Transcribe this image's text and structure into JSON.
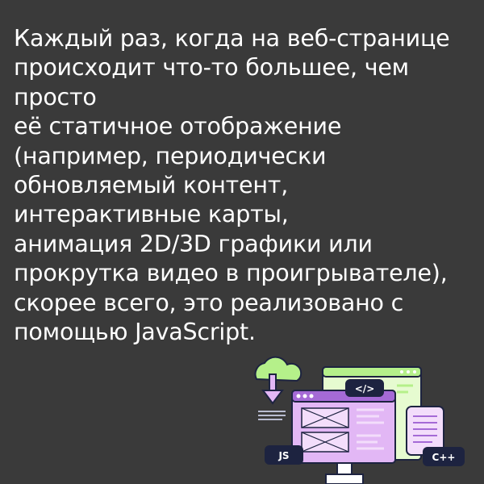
{
  "paragraph": {
    "lines": [
      "Каждый раз, когда на веб-странице",
      "происходит что-то большее, чем",
      "просто",
      "её статичное отображение",
      "(например, периодически",
      "обновляемый контент,",
      "интерактивные карты,",
      "анимация 2D/3D графики или",
      "прокрутка видео в проигрывателе),",
      "скорее всего, это реализовано с",
      "помощью JavaScript."
    ]
  },
  "illustration": {
    "code_tag": "</>",
    "js_badge": "JS",
    "cpp_badge": "C++",
    "icons": [
      "cloud-download-icon",
      "browser-window",
      "code-window",
      "document-icon",
      "monitor"
    ]
  },
  "colors": {
    "background": "#3a3a3a",
    "text": "#ffffff",
    "lavender": "#e2b7f5",
    "lavender_light": "#f3ddfb",
    "purple_bar": "#a56ad6",
    "green": "#b5f08a",
    "green_light": "#e6fbd0",
    "navy": "#1d2340",
    "outline": "#1d2340"
  }
}
